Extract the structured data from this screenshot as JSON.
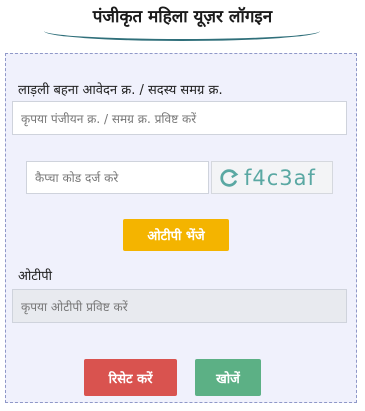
{
  "header": {
    "title": "पंजीकृत महिला यूज़र लॉगइन"
  },
  "form": {
    "id_label": "लाड़ली बहना आवेदन क्र. / सदस्य समग्र क्र.",
    "id_placeholder": "कृपया पंजीयन क्र. / समग्र क्र. प्रविष्ट करें",
    "captcha_placeholder": "कैप्चा कोड दर्ज करे",
    "captcha_code": "f4c3af",
    "send_otp_label": "ओटीपी भेंजे",
    "otp_label": "ओटीपी",
    "otp_placeholder": "कृपया ओटीपी प्रविष्ट करें",
    "reset_label": "रिसेट करें",
    "search_label": "खोजें"
  },
  "colors": {
    "send_otp": "#f4b400",
    "reset": "#d9534f",
    "search": "#5cb085",
    "captcha_text": "#5aa8a3"
  }
}
